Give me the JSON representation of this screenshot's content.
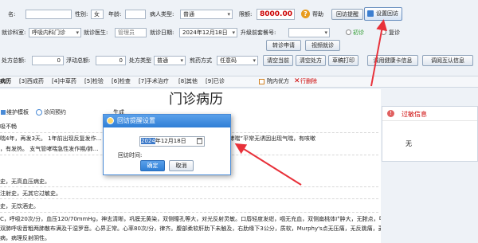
{
  "colors": {
    "accent_red": "#cc0000",
    "title_blue": "#2f7fd6",
    "arrow_red": "#e8313a"
  },
  "patient": {
    "name_label": "名:",
    "name_value": "",
    "gender_label": "性别:",
    "gender_value": "女",
    "age_label": "年龄:",
    "age_value": "",
    "type_label": "病人类型:",
    "type_value": "普通",
    "limit_label": "限额:",
    "limit_value": "8000.00",
    "help_label": "帮助",
    "revisit_remind_label": "回访提醒",
    "revisit_settings_label": "设置回访"
  },
  "visit": {
    "dept_label": "就诊科室:",
    "dept_value": "呼吸内科门诊",
    "doctor_label": "就诊医生:",
    "doctor_value": "管理员",
    "date_label": "就诊日期:",
    "date_value": "2024年12月18日",
    "upgrade_label": "升级前套餐号:",
    "upgrade_value": "",
    "first_visit_label": "初诊",
    "revisit_label": "复诊",
    "transfer_btn": "转诊申请",
    "video_btn": "视频就诊"
  },
  "fees": {
    "total_label": "处方总额:",
    "total_value": "0",
    "float_label": "浮动总额:",
    "float_value": "0",
    "rx_type_label": "处方类型",
    "rx_type_value": "普通",
    "decoct_label": "煎药方式",
    "decoct_value": "任意码",
    "buttons": [
      "请空当前",
      "清空处方",
      "草稿打印",
      "调用健康卡信息",
      "调阅互认信息"
    ]
  },
  "tabs": [
    "病历",
    "[3]西成药",
    "[4]中草药",
    "[5]检验",
    "[6]检查",
    "[7]手术治疗",
    "[8]其他",
    "[9]已诊"
  ],
  "tab_extra": {
    "inpatient_label": "院内优方",
    "delete_label": "行删除"
  },
  "doc_tools": {
    "maintain": "维护模板",
    "followup": "诊间预约",
    "generate": "生成"
  },
  "record": {
    "title": "门诊病历",
    "lines": [
      "吸不畅",
      "喘4年，再发3天。  1年前出现反复发作…                                            咳嗽，口服氨茶碱等药物后缓解，外院诊断“支气管哮喘”平常无诱因出现气喘，有咳嗽",
      "，有发热。  支气管哮喘急性发作期/肺…",
      "史，无高血压病史。",
      "注射史，无其它过敏史。",
      "史，无饮酒史。",
      "C，呼吸20次/分，血压120/70mmHg，神志清晰，巩膜无黄染，双侧瞳孔等大，对光反射灵敏。口唇轻度发绀，咽无充血，双侧扁桃体I°肿大，无脓点，甲状腺无大，颈静",
      "双肺呼吸音粗两肺散布满及干湿罗音。心界正常。心率80次/分，律齐。腹部柔软肝肋下未触及，右肋缘下3公分，质软，Murphy's点无压痛，无反跳痛，麦氏点有压痛，肾区",
      "病，病理反射阴性。"
    ]
  },
  "right_panel": {
    "title": "过敏信息",
    "value": "无"
  },
  "dialog": {
    "title": "回访提醒设置",
    "date_year": "2024",
    "date_rest": "年12月18日",
    "time_label": "回访时间:",
    "confirm_btn": "确定",
    "cancel_btn": "取消"
  }
}
